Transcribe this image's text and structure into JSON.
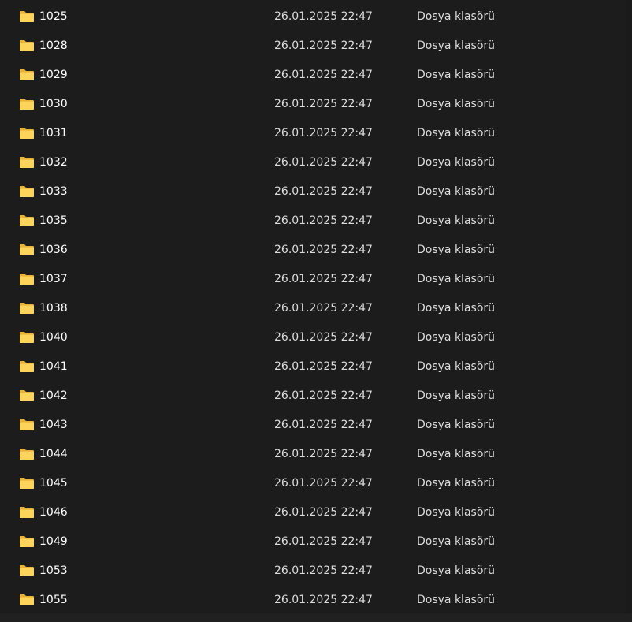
{
  "icon": "folder-icon",
  "colors": {
    "background": "#1c1c1c",
    "folder_back": "#e8b33c",
    "folder_front": "#fcd45c",
    "text": "#ffffff"
  },
  "rows": [
    {
      "name": "1025",
      "date": "26.01.2025 22:47",
      "type": "Dosya klasörü"
    },
    {
      "name": "1028",
      "date": "26.01.2025 22:47",
      "type": "Dosya klasörü"
    },
    {
      "name": "1029",
      "date": "26.01.2025 22:47",
      "type": "Dosya klasörü"
    },
    {
      "name": "1030",
      "date": "26.01.2025 22:47",
      "type": "Dosya klasörü"
    },
    {
      "name": "1031",
      "date": "26.01.2025 22:47",
      "type": "Dosya klasörü"
    },
    {
      "name": "1032",
      "date": "26.01.2025 22:47",
      "type": "Dosya klasörü"
    },
    {
      "name": "1033",
      "date": "26.01.2025 22:47",
      "type": "Dosya klasörü"
    },
    {
      "name": "1035",
      "date": "26.01.2025 22:47",
      "type": "Dosya klasörü"
    },
    {
      "name": "1036",
      "date": "26.01.2025 22:47",
      "type": "Dosya klasörü"
    },
    {
      "name": "1037",
      "date": "26.01.2025 22:47",
      "type": "Dosya klasörü"
    },
    {
      "name": "1038",
      "date": "26.01.2025 22:47",
      "type": "Dosya klasörü"
    },
    {
      "name": "1040",
      "date": "26.01.2025 22:47",
      "type": "Dosya klasörü"
    },
    {
      "name": "1041",
      "date": "26.01.2025 22:47",
      "type": "Dosya klasörü"
    },
    {
      "name": "1042",
      "date": "26.01.2025 22:47",
      "type": "Dosya klasörü"
    },
    {
      "name": "1043",
      "date": "26.01.2025 22:47",
      "type": "Dosya klasörü"
    },
    {
      "name": "1044",
      "date": "26.01.2025 22:47",
      "type": "Dosya klasörü"
    },
    {
      "name": "1045",
      "date": "26.01.2025 22:47",
      "type": "Dosya klasörü"
    },
    {
      "name": "1046",
      "date": "26.01.2025 22:47",
      "type": "Dosya klasörü"
    },
    {
      "name": "1049",
      "date": "26.01.2025 22:47",
      "type": "Dosya klasörü"
    },
    {
      "name": "1053",
      "date": "26.01.2025 22:47",
      "type": "Dosya klasörü"
    },
    {
      "name": "1055",
      "date": "26.01.2025 22:47",
      "type": "Dosya klasörü"
    }
  ]
}
